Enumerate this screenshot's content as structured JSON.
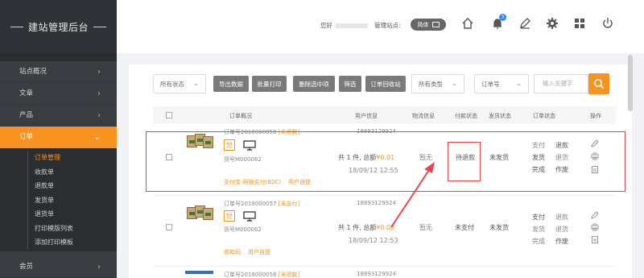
{
  "brand": {
    "title": "建站管理后台"
  },
  "sidebar": {
    "items": [
      {
        "label": "站点概况"
      },
      {
        "label": "文章"
      },
      {
        "label": "产品"
      },
      {
        "label": "订单"
      },
      {
        "label": "会员"
      }
    ],
    "sub_items": [
      {
        "label": "订单管理"
      },
      {
        "label": "收款单"
      },
      {
        "label": "退款单"
      },
      {
        "label": "发货单"
      },
      {
        "label": "退货单"
      },
      {
        "label": "打印模版列表"
      },
      {
        "label": "添加打印模板"
      }
    ]
  },
  "header": {
    "greeting": "您好",
    "site_label": "管理站点:",
    "lang_button": "简体",
    "notification_count": "3"
  },
  "toolbar": {
    "status_filter": "所有状态",
    "buttons": [
      "导出数据",
      "批量打印",
      "删除选中项",
      "筛选",
      "订单回收站"
    ],
    "type_filter": "所有类型",
    "field_filter": "订单号",
    "search_placeholder": "输入关键字"
  },
  "table": {
    "headers": [
      "订单概况",
      "用户信息",
      "物流信息",
      "付款状态",
      "发货状态",
      "订单状态",
      "操作"
    ],
    "rows": [
      {
        "order_no": "订单号2018000058",
        "order_tag": "[未退款]",
        "fen": "分",
        "goods_no": "货号M000062",
        "payment_line": "支付宝-网银支付(B2C)",
        "payment_extra": "用户自提",
        "phone": "18893129924",
        "total_prefix": "共 1 件, 总额",
        "total_amount": "¥0.01",
        "time": "18/09/12 12:55",
        "logistics": "暂无",
        "payment_status": "待退款",
        "ship_status": "未发货",
        "order_ops": [
          [
            "支付",
            "退款"
          ],
          [
            "发货",
            "退货"
          ],
          [
            "完成",
            "作废"
          ]
        ]
      },
      {
        "order_no": "订单号2018000057",
        "order_tag": "[未支付]",
        "fen": "分",
        "goods_no": "货号M000062",
        "payment_line": "收款码",
        "payment_extra": "用户自提",
        "phone": "18893129924",
        "total_prefix": "共 1 件, 总额",
        "total_amount": "¥0.02",
        "time": "18/09/12 12:53",
        "logistics": "暂无",
        "payment_status": "未支付",
        "ship_status": "未发货",
        "order_ops": [
          [
            "支付",
            "退款"
          ],
          [
            "发货",
            "退货"
          ],
          [
            "完成",
            "作废"
          ]
        ]
      },
      {
        "order_no": "订单号2018000056",
        "order_tag": "[未退款]",
        "phone": "18893129924"
      }
    ]
  },
  "colors": {
    "accent": "#f7931e",
    "highlight": "#e8474e",
    "sidebar": "#3a3d42"
  }
}
